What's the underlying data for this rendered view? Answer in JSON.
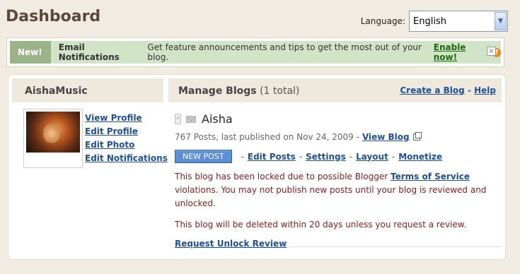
{
  "header": {
    "title": "Dashboard"
  },
  "language": {
    "label": "Language:",
    "selected": "English"
  },
  "notice": {
    "badge": "New!",
    "title": "Email Notifications",
    "text": "Get feature announcements and tips to get the most out of your blog.",
    "link": "Enable now!",
    "help_glyph": "?",
    "close_glyph": "×"
  },
  "profile": {
    "username": "AishaMusic",
    "links": [
      "View Profile",
      "Edit Profile",
      "Edit Photo",
      "Edit Notifications"
    ]
  },
  "manage": {
    "title": "Manage Blogs",
    "count": "(1 total)",
    "create_link": "Create a Blog",
    "separator": "-",
    "help_link": "Help"
  },
  "blog": {
    "name": "Aisha",
    "meta": "767 Posts, last published on Nov 24, 2009 -",
    "view_link": "View Blog",
    "new_post": "NEW POST",
    "actions": [
      "Edit Posts",
      "Settings",
      "Layout",
      "Monetize"
    ],
    "action_sep": "-",
    "warning_pre": "This blog has been locked due to possible Blogger",
    "warning_link": "Terms of Service",
    "warning_post": "violations. You may not publish new posts until your blog is reviewed and unlocked.",
    "deletion": "This blog will be deleted within 20 days unless you request a review.",
    "unlock_link": "Request Unlock Review"
  }
}
